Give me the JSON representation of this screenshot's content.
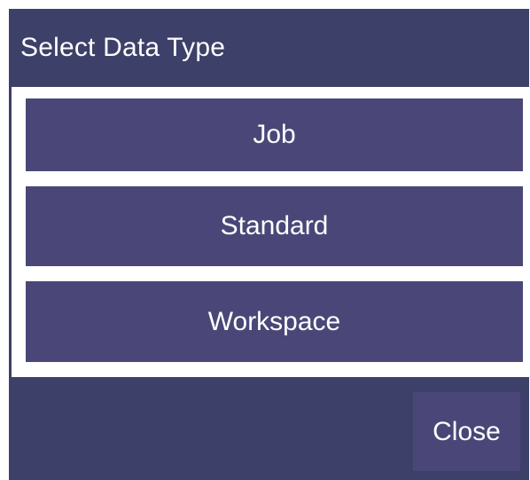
{
  "dialog": {
    "title": "Select Data Type",
    "options": [
      {
        "label": "Job"
      },
      {
        "label": "Standard"
      },
      {
        "label": "Workspace"
      }
    ],
    "close_label": "Close"
  },
  "colors": {
    "dialog_background": "#3d4068",
    "button_background": "#4a4778",
    "text": "#ffffff"
  }
}
